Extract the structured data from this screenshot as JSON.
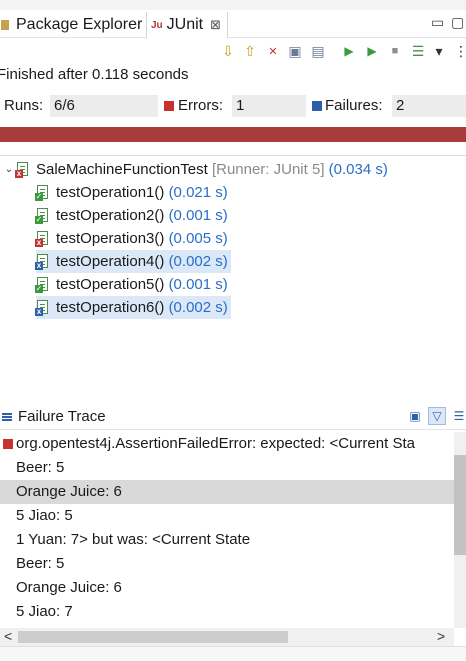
{
  "tabs": [
    {
      "label": "Package Explorer",
      "icon": "package-explorer-icon"
    },
    {
      "label": "JUnit",
      "icon": "junit-icon",
      "active": true,
      "close": "⊠"
    }
  ],
  "window_controls": {
    "minimize": "▭",
    "restore": "▢"
  },
  "toolbar": {
    "buttons": [
      {
        "name": "next-failure-icon",
        "glyph": "⇩"
      },
      {
        "name": "previous-failure-icon",
        "glyph": "⇧"
      },
      {
        "name": "show-failures-only-icon",
        "glyph": "✕"
      },
      {
        "name": "scroll-lock-icon",
        "glyph": "▣"
      },
      {
        "name": "layout-icon",
        "glyph": "▤"
      },
      {
        "name": "rerun-test-icon",
        "glyph": "▶"
      },
      {
        "name": "rerun-failed-first-icon",
        "glyph": "▶"
      },
      {
        "name": "stop-icon",
        "glyph": "■"
      },
      {
        "name": "test-run-history-icon",
        "glyph": "☰"
      },
      {
        "name": "view-menu-icon",
        "glyph": "▾"
      },
      {
        "name": "more-icon",
        "glyph": "⋮"
      }
    ]
  },
  "status": {
    "text": "Finished after 0.118 seconds"
  },
  "counters": {
    "runs_label": "Runs:",
    "runs_value": "6/6",
    "errors_label": "Errors:",
    "errors_value": "1",
    "failures_label": "Failures:",
    "failures_value": "2"
  },
  "colors": {
    "progress_bar": "#a83b3b",
    "selection": "#dbe8f7",
    "time": "#2a6ec9"
  },
  "tree": {
    "root": {
      "name": "SaleMachineFunctionTest",
      "runner": "[Runner: JUnit 5]",
      "time": "(0.034 s)",
      "status": "error",
      "expanded_glyph": "⌄"
    },
    "items": [
      {
        "name": "testOperation1()",
        "time": "(0.021 s)",
        "status": "passed",
        "selected": false
      },
      {
        "name": "testOperation2()",
        "time": "(0.001 s)",
        "status": "passed",
        "selected": false
      },
      {
        "name": "testOperation3()",
        "time": "(0.005 s)",
        "status": "error",
        "selected": false
      },
      {
        "name": "testOperation4()",
        "time": "(0.002 s)",
        "status": "failure",
        "selected": true
      },
      {
        "name": "testOperation5()",
        "time": "(0.001 s)",
        "status": "passed",
        "selected": false
      },
      {
        "name": "testOperation6()",
        "time": "(0.002 s)",
        "status": "failure",
        "selected": true
      }
    ]
  },
  "failure_trace": {
    "title": "Failure Trace",
    "lines": [
      {
        "text": "org.opentest4j.AssertionFailedError: expected: <Current Sta",
        "selected": false,
        "lead_icon": "error-icon"
      },
      {
        "text": "Beer: 5",
        "selected": false
      },
      {
        "text": "Orange Juice: 6",
        "selected": true
      },
      {
        "text": "5 Jiao: 5",
        "selected": false
      },
      {
        "text": "1 Yuan: 7> but was: <Current State",
        "selected": false
      },
      {
        "text": "Beer: 5",
        "selected": false
      },
      {
        "text": "Orange Juice: 6",
        "selected": false
      },
      {
        "text": "5 Jiao: 7",
        "selected": false
      }
    ]
  },
  "scrollbar": {
    "left_arrow": "<",
    "right_arrow": ">"
  }
}
